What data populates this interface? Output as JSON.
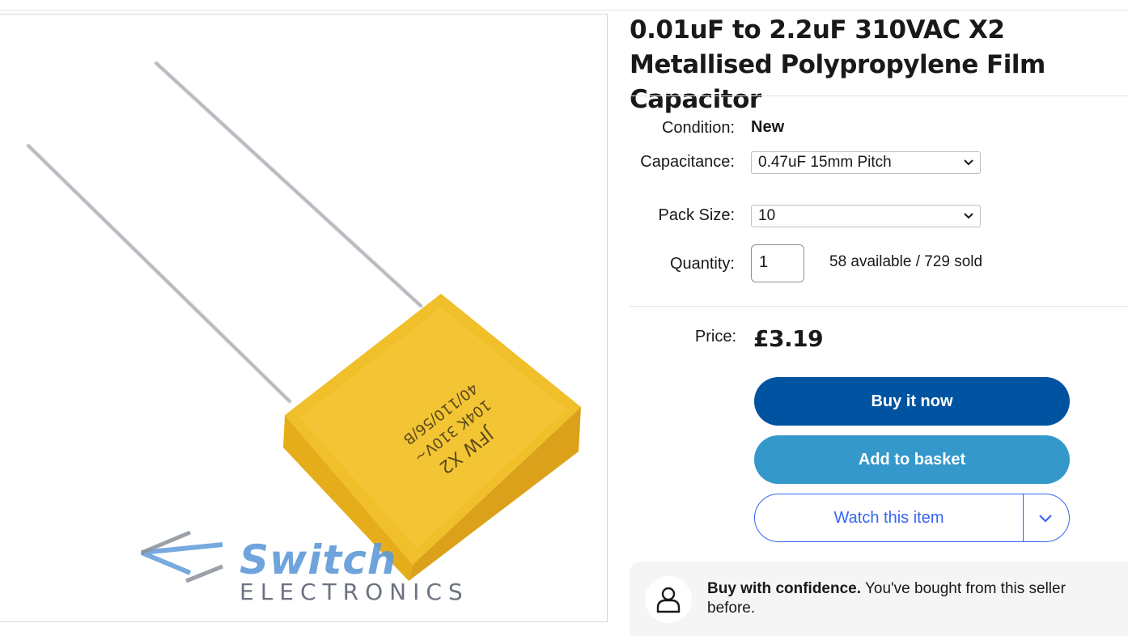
{
  "product": {
    "title": "0.01uF to 2.2uF 310VAC X2 Metallised Polypropylene Film Capacitor",
    "image": {
      "brand_name": "Switch",
      "brand_sub": "ELECTRONICS",
      "capacitor_marking": "JFW X2 104K 310V~ 40/110/56/B"
    }
  },
  "details": {
    "condition_label": "Condition:",
    "condition_value": "New",
    "capacitance_label": "Capacitance:",
    "capacitance_value": "0.47uF 15mm Pitch",
    "pack_label": "Pack Size:",
    "pack_value": "10",
    "quantity_label": "Quantity:",
    "quantity_value": "1",
    "availability": "58 available / 729 sold"
  },
  "pricing": {
    "price_label": "Price:",
    "price_value": "£3.19"
  },
  "actions": {
    "buy_now": "Buy it now",
    "add_to_basket": "Add to basket",
    "watch": "Watch this item"
  },
  "confidence": {
    "title": "Buy with confidence.",
    "text": "You've bought from this seller before."
  },
  "colors": {
    "buy_now": "#0053a0",
    "add_to_basket": "#3498ca",
    "watch_outline": "#3665f3",
    "capacitor_body": "#f2c230"
  }
}
